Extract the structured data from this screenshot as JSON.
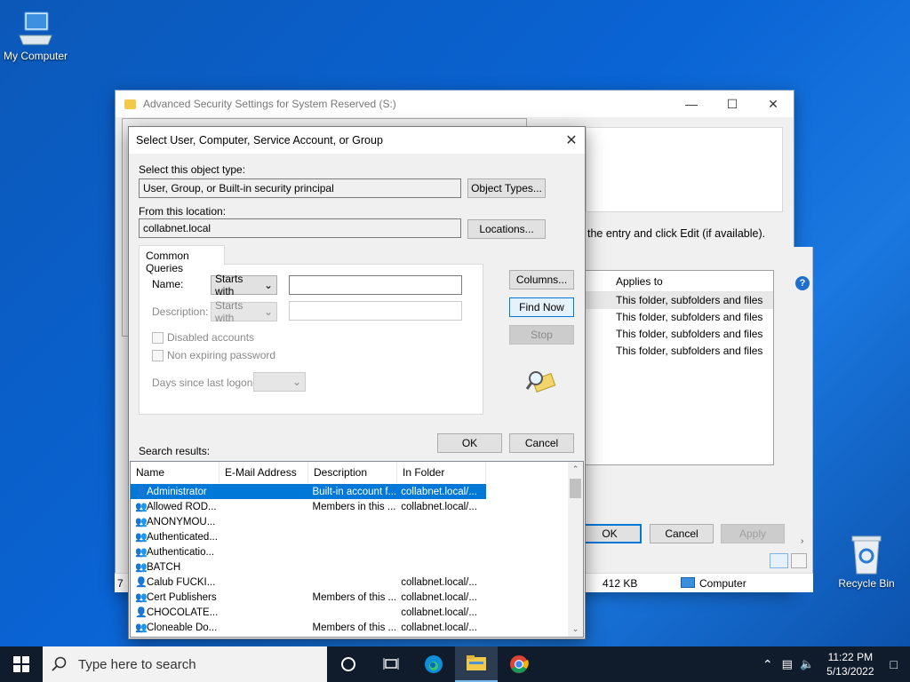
{
  "desktop": {
    "my_computer": "My Computer",
    "recycle_bin": "Recycle Bin"
  },
  "adv_window": {
    "title": "Advanced Security Settings for System Reserved (S:)",
    "hint": "the entry and click Edit (if available).",
    "applies_to_header": "Applies to",
    "rows": [
      "This folder, subfolders and files",
      "This folder, subfolders and files",
      "This folder, subfolders and files",
      "This folder, subfolders and files"
    ],
    "ok": "OK",
    "cancel": "Cancel",
    "apply": "Apply",
    "status_left": "7",
    "status_size": "412 KB",
    "status_computer": "Computer"
  },
  "dialog": {
    "title": "Select User, Computer, Service Account, or Group",
    "object_type_label": "Select this object type:",
    "object_type_value": "User, Group, or Built-in security principal",
    "object_types_button": "Object Types...",
    "location_label": "From this location:",
    "location_value": "collabnet.local",
    "locations_button": "Locations...",
    "tab_label": "Common Queries",
    "name_label": "Name:",
    "name_mode": "Starts with",
    "description_label": "Description:",
    "description_mode": "Starts with",
    "disabled_accounts": "Disabled accounts",
    "non_expiring": "Non expiring password",
    "days_label": "Days since last logon:",
    "columns_button": "Columns...",
    "find_now_button": "Find Now",
    "stop_button": "Stop",
    "ok_button": "OK",
    "cancel_button": "Cancel",
    "search_results_label": "Search results:",
    "columns": [
      "Name",
      "E-Mail Address",
      "Description",
      "In Folder"
    ],
    "results": [
      {
        "name": "Administrator",
        "email": "",
        "description": "Built-in account f...",
        "folder": "collabnet.local/...",
        "icon": "user-icon"
      },
      {
        "name": "Allowed ROD...",
        "email": "",
        "description": "Members in this ...",
        "folder": "collabnet.local/...",
        "icon": "group-icon"
      },
      {
        "name": "ANONYMOU...",
        "email": "",
        "description": "",
        "folder": "",
        "icon": "special-group-icon"
      },
      {
        "name": "Authenticated...",
        "email": "",
        "description": "",
        "folder": "",
        "icon": "special-group-icon"
      },
      {
        "name": "Authenticatio...",
        "email": "",
        "description": "",
        "folder": "",
        "icon": "special-group-icon"
      },
      {
        "name": "BATCH",
        "email": "",
        "description": "",
        "folder": "",
        "icon": "special-group-icon"
      },
      {
        "name": "Calub FUCKI...",
        "email": "",
        "description": "",
        "folder": "collabnet.local/...",
        "icon": "user-icon"
      },
      {
        "name": "Cert Publishers",
        "email": "",
        "description": "Members of this ...",
        "folder": "collabnet.local/...",
        "icon": "group-icon"
      },
      {
        "name": "CHOCOLATE...",
        "email": "",
        "description": "",
        "folder": "collabnet.local/...",
        "icon": "user-icon"
      },
      {
        "name": "Cloneable Do...",
        "email": "",
        "description": "Members of this ...",
        "folder": "collabnet.local/...",
        "icon": "group-icon"
      }
    ]
  },
  "taskbar": {
    "search_placeholder": "Type here to search",
    "time": "11:22 PM",
    "date": "5/13/2022"
  }
}
